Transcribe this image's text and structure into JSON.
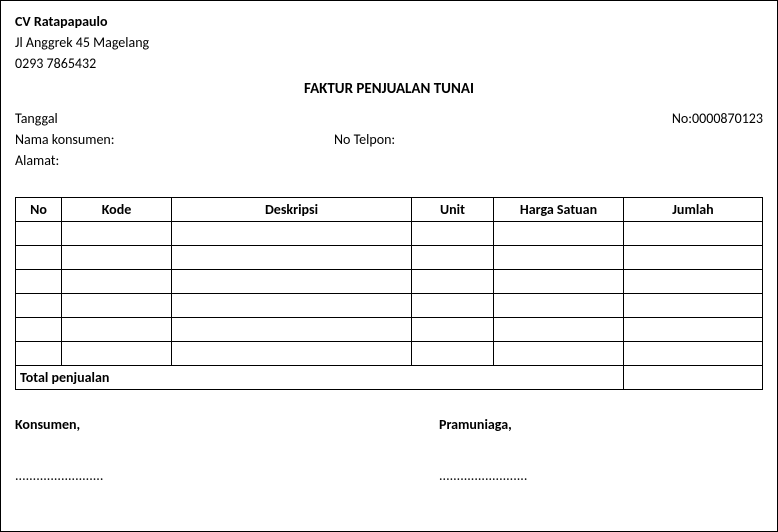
{
  "company": {
    "name": "CV Ratapapaulo",
    "address": "Jl Anggrek 45 Magelang",
    "phone": "0293 7865432"
  },
  "title": "FAKTUR PENJUALAN TUNAI",
  "meta": {
    "tanggal_label": "Tanggal",
    "no_label": "No:",
    "no_value": "0000870123",
    "nama_konsumen_label": "Nama konsumen:",
    "no_telpon_label": "No Telpon:",
    "alamat_label": "Alamat:"
  },
  "table": {
    "headers": {
      "no": "No",
      "kode": "Kode",
      "deskripsi": "Deskripsi",
      "unit": "Unit",
      "harga_satuan": "Harga Satuan",
      "jumlah": "Jumlah"
    },
    "total_label": "Total penjualan"
  },
  "signatures": {
    "konsumen": "Konsumen,",
    "pramuniaga": "Pramuniaga,",
    "dots": "........................."
  }
}
